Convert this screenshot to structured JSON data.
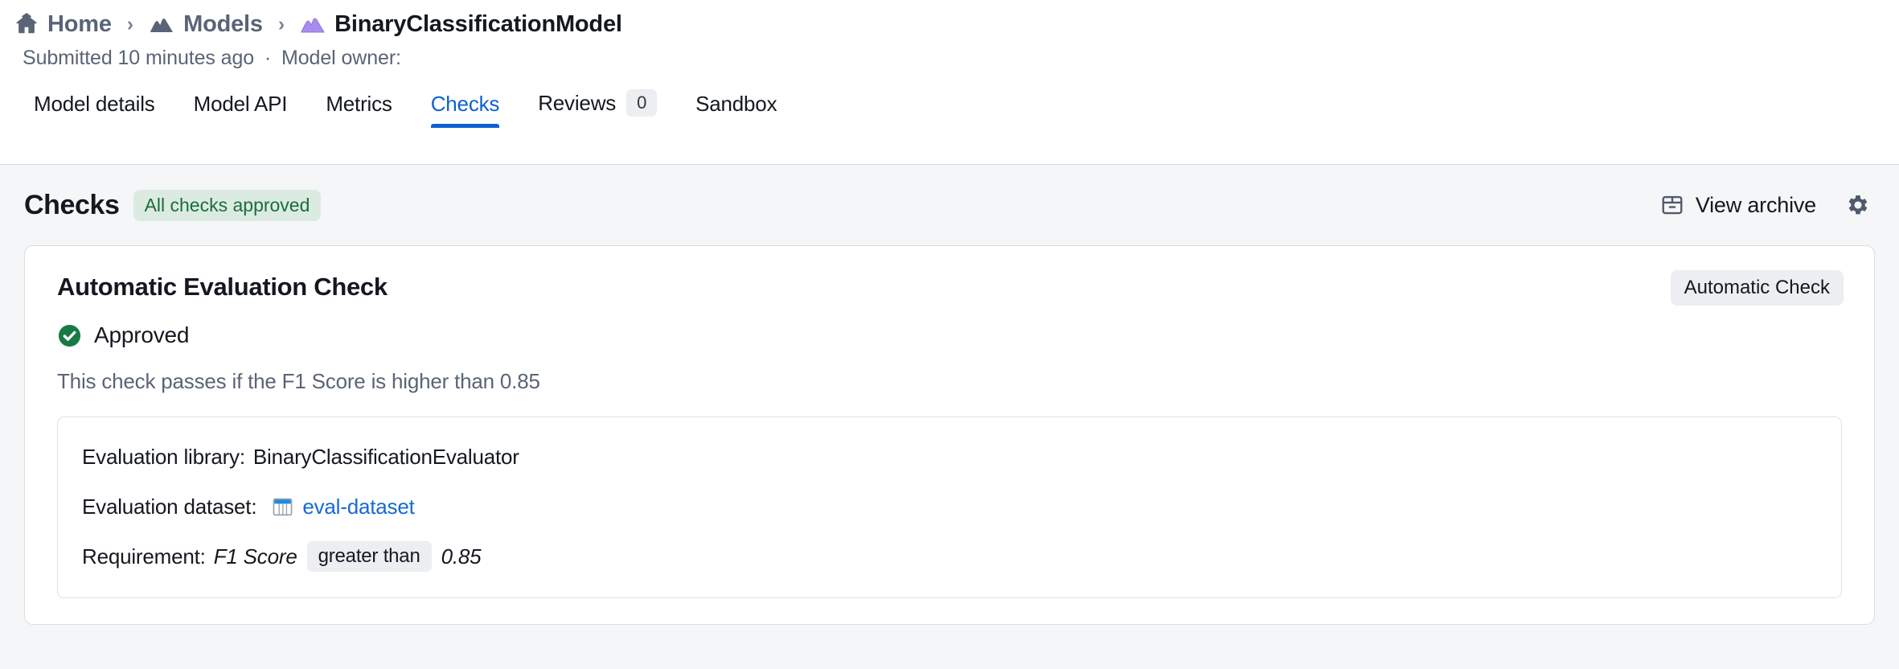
{
  "breadcrumb": {
    "items": [
      {
        "label": "Home",
        "icon": "home-icon",
        "current": false
      },
      {
        "label": "Models",
        "icon": "model-mountain-icon",
        "current": false
      },
      {
        "label": "BinaryClassificationModel",
        "icon": "model-mountain-purple-icon",
        "current": true
      }
    ],
    "separator": "›"
  },
  "meta": {
    "submitted": "Submitted 10 minutes ago",
    "separator": "·",
    "owner_label": "Model owner:"
  },
  "tabs": [
    {
      "label": "Model details",
      "active": false,
      "count": null
    },
    {
      "label": "Model API",
      "active": false,
      "count": null
    },
    {
      "label": "Metrics",
      "active": false,
      "count": null
    },
    {
      "label": "Checks",
      "active": true,
      "count": null
    },
    {
      "label": "Reviews",
      "active": false,
      "count": "0"
    },
    {
      "label": "Sandbox",
      "active": false,
      "count": null
    }
  ],
  "checks_section": {
    "title": "Checks",
    "status_badge": "All checks approved",
    "view_archive_label": "View archive",
    "archive_icon": "archive-box-icon",
    "settings_icon": "gear-icon"
  },
  "check_card": {
    "title": "Automatic Evaluation Check",
    "type_chip": "Automatic Check",
    "status": "Approved",
    "status_icon": "check-circle-icon",
    "description": "This check passes if the F1 Score is higher than 0.85",
    "details": {
      "library_label": "Evaluation library:",
      "library_value": "BinaryClassificationEvaluator",
      "dataset_label": "Evaluation dataset:",
      "dataset_icon": "table-dataset-icon",
      "dataset_value": "eval-dataset",
      "requirement_label": "Requirement:",
      "requirement_metric": "F1 Score",
      "requirement_operator": "greater than",
      "requirement_threshold": "0.85"
    }
  },
  "colors": {
    "accent_blue": "#0b62d0",
    "link_blue": "#1769d6",
    "approved_green": "#1c6c3c",
    "approved_green_bg": "#dcebe1",
    "check_circle_green": "#1a7a46",
    "model_purple": "#a98cf0",
    "page_bg": "#f4f6f8",
    "muted_text": "#5a6477"
  }
}
